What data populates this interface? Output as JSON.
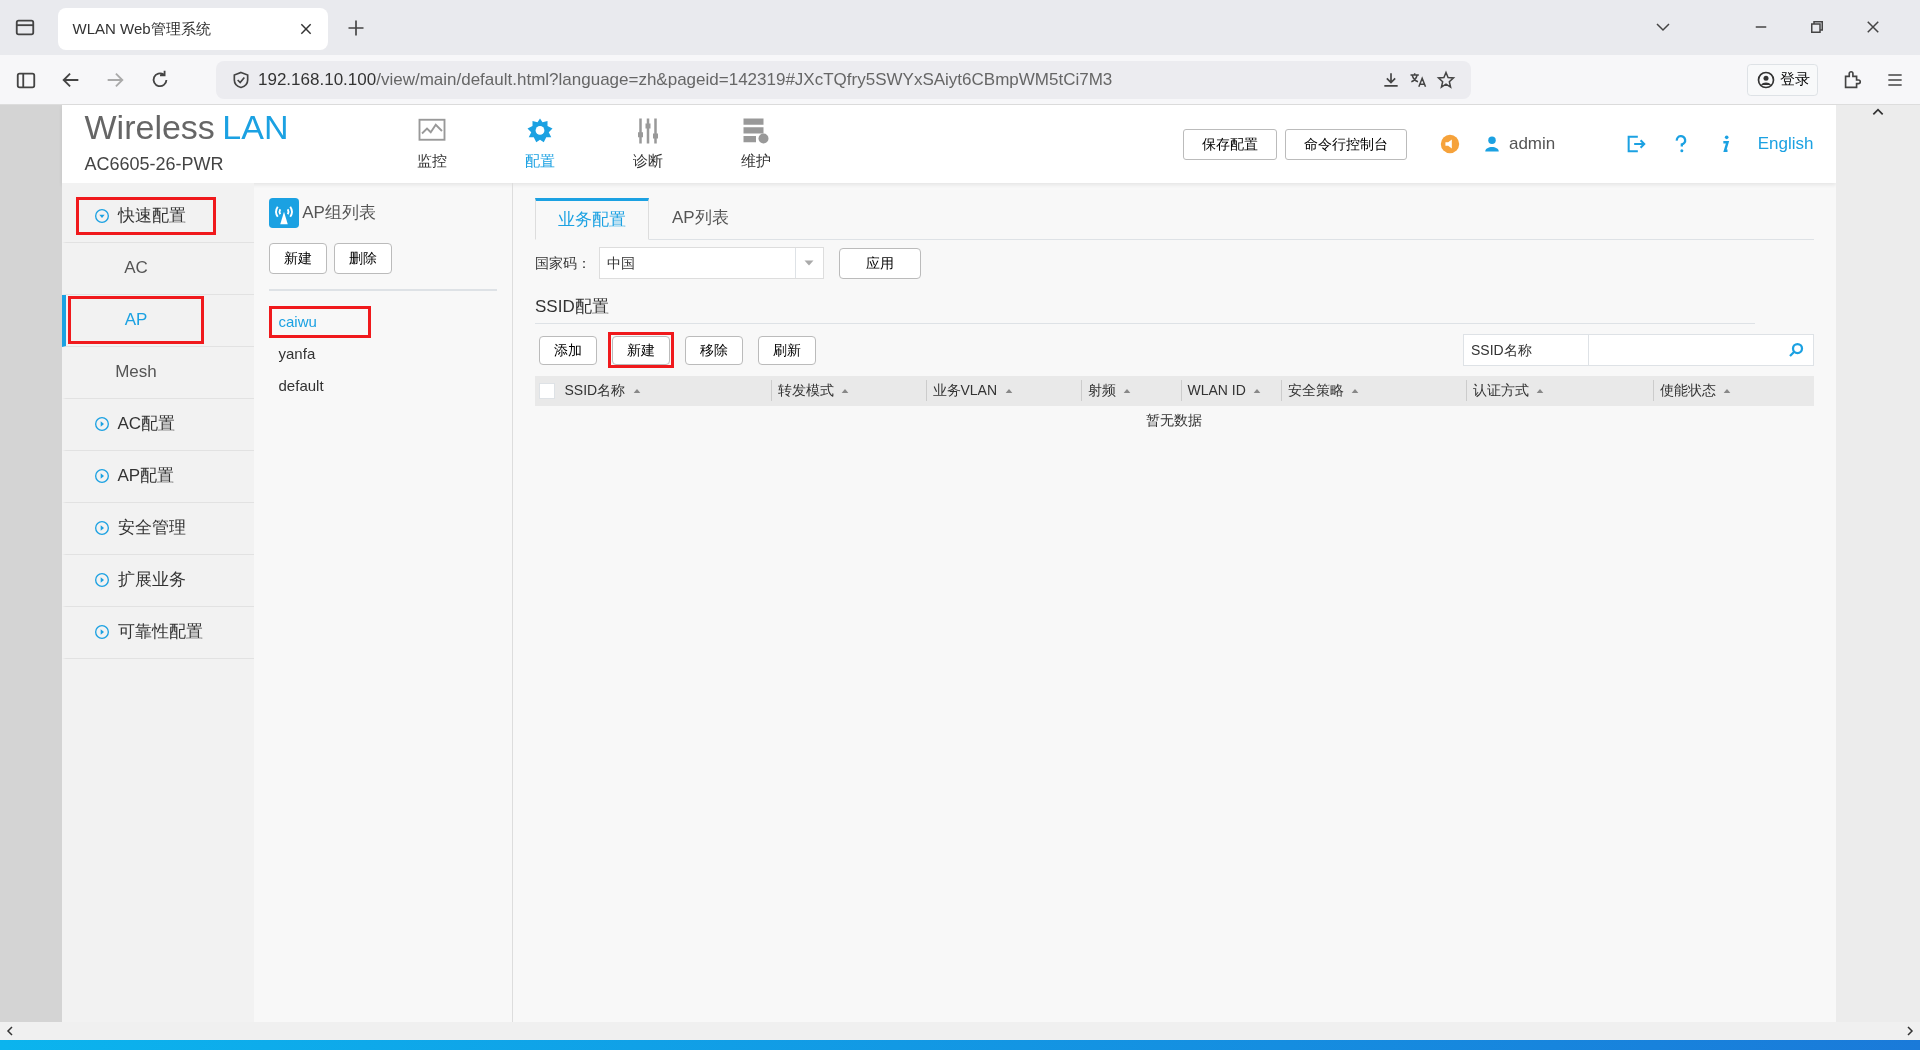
{
  "browser": {
    "tab_title": "WLAN Web管理系统",
    "url_host": "192.168.10.100",
    "url_path": "/view/main/default.html?language=zh&pageid=142319#JXcTQfry5SWYxSAiyt6CBmpWM5tCi7M3",
    "login": "登录"
  },
  "header": {
    "brand_dark": "Wireless",
    "brand_blue": "LAN",
    "model": "AC6605-26-PWR",
    "nav": [
      {
        "label": "监控",
        "kind": "monitor",
        "selected": false
      },
      {
        "label": "配置",
        "kind": "gear",
        "selected": true
      },
      {
        "label": "诊断",
        "kind": "sliders",
        "selected": false
      },
      {
        "label": "维护",
        "kind": "server",
        "selected": false
      }
    ],
    "buttons": [
      "保存配置",
      "命令行控制台"
    ],
    "user": "admin",
    "language": "English"
  },
  "sidebar": [
    {
      "label": "快速配置",
      "kind": "section",
      "expanded": true,
      "selected": false,
      "highlighted": true
    },
    {
      "label": "AC",
      "kind": "sub",
      "selected": false,
      "highlighted": false
    },
    {
      "label": "AP",
      "kind": "sub",
      "selected": true,
      "highlighted": true
    },
    {
      "label": "Mesh",
      "kind": "sub",
      "selected": false,
      "highlighted": false
    },
    {
      "label": "AC配置",
      "kind": "section",
      "expanded": false,
      "selected": false,
      "highlighted": false
    },
    {
      "label": "AP配置",
      "kind": "section",
      "expanded": false,
      "selected": false,
      "highlighted": false
    },
    {
      "label": "安全管理",
      "kind": "section",
      "expanded": false,
      "selected": false,
      "highlighted": false
    },
    {
      "label": "扩展业务",
      "kind": "section",
      "expanded": false,
      "selected": false,
      "highlighted": false
    },
    {
      "label": "可靠性配置",
      "kind": "section",
      "expanded": false,
      "selected": false,
      "highlighted": false
    }
  ],
  "ap_groups": {
    "title": "AP组列表",
    "buttons": [
      "新建",
      "删除"
    ],
    "groups": [
      {
        "name": "caiwu",
        "selected": true,
        "highlighted": true
      },
      {
        "name": "yanfa",
        "selected": false,
        "highlighted": false
      },
      {
        "name": "default",
        "selected": false,
        "highlighted": false
      }
    ]
  },
  "main": {
    "tabs": [
      {
        "label": "业务配置",
        "selected": true
      },
      {
        "label": "AP列表",
        "selected": false
      }
    ],
    "country_label": "国家码：",
    "country_value": "中国",
    "apply": "应用",
    "ssid_title": "SSID配置",
    "buttons": [
      {
        "label": "添加",
        "highlighted": false
      },
      {
        "label": "新建",
        "highlighted": true
      },
      {
        "label": "移除",
        "highlighted": false
      },
      {
        "label": "刷新",
        "highlighted": false
      }
    ],
    "search_label": "SSID名称",
    "table": {
      "select_all_checked": false,
      "columns": [
        "SSID名称",
        "转发模式",
        "业务VLAN",
        "射频",
        "WLAN ID",
        "安全策略",
        "认证方式",
        "使能状态"
      ],
      "empty": "暂无数据"
    }
  }
}
